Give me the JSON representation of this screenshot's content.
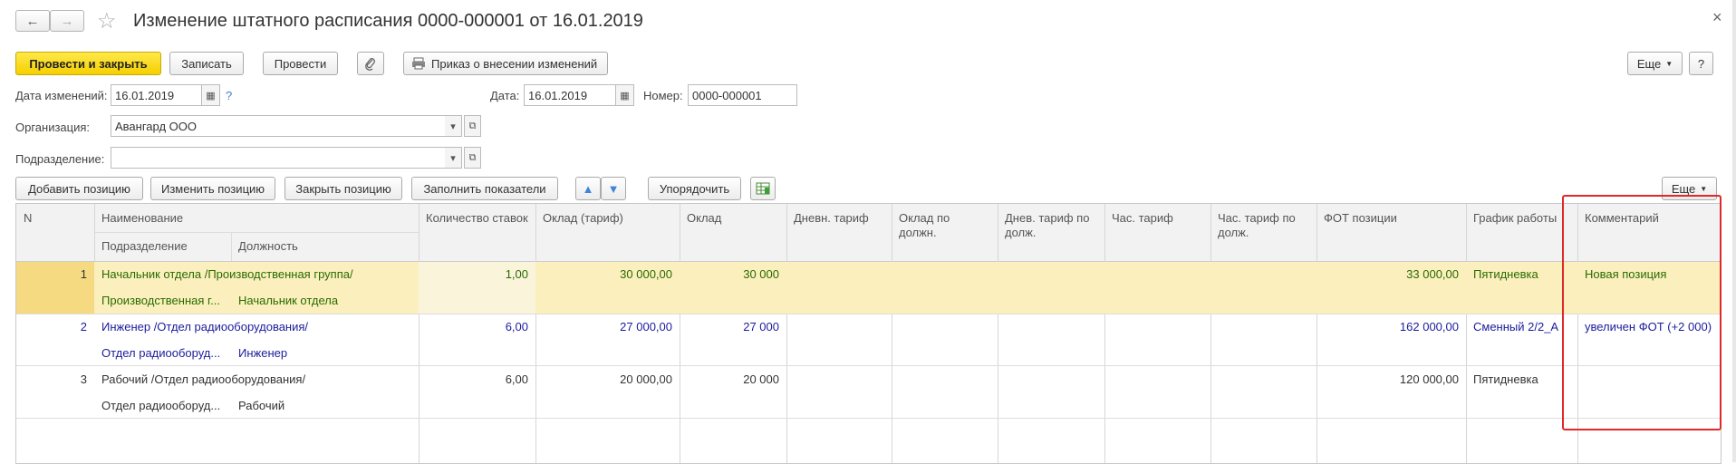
{
  "window": {
    "title": "Изменение штатного расписания 0000-000001 от 16.01.2019",
    "close_glyph": "×",
    "back_glyph": "←",
    "forward_glyph": "→",
    "star_glyph": "☆"
  },
  "toolbar": {
    "post_close": "Провести и закрыть",
    "save": "Записать",
    "post": "Провести",
    "attach_icon": "paperclip-icon",
    "print_order": "Приказ о внесении изменений",
    "more": "Еще",
    "help": "?"
  },
  "form": {
    "change_date_label": "Дата изменений:",
    "change_date_value": "16.01.2019",
    "help_mark": "?",
    "date_label": "Дата:",
    "date_value": "16.01.2019",
    "number_label": "Номер:",
    "number_value": "0000-000001",
    "org_label": "Организация:",
    "org_value": "Авангард ООО",
    "dept_label": "Подразделение:",
    "dept_value": ""
  },
  "table_toolbar": {
    "add": "Добавить позицию",
    "edit": "Изменить позицию",
    "close": "Закрыть позицию",
    "fill": "Заполнить показатели",
    "sort": "Упорядочить",
    "more": "Еще"
  },
  "table": {
    "headers": {
      "n": "N",
      "name": "Наименование",
      "dept": "Подразделение",
      "position": "Должность",
      "rate_count": "Количество ставок",
      "salary_tariff": "Оклад (тариф)",
      "salary": "Оклад",
      "day_tariff": "Дневн. тариф",
      "salary_by_pos": "Оклад по должн.",
      "day_tariff_by_pos": "Днев. тариф по долж.",
      "hour_tariff": "Час. тариф",
      "hour_tariff_by_pos": "Час. тариф по долж.",
      "fot": "ФОТ позиции",
      "schedule": "График работы",
      "comment": "Комментарий"
    },
    "rows": [
      {
        "n": "1",
        "name": "Начальник отдела /Производственная группа/",
        "dept": "Производственная г...",
        "position": "Начальник отдела",
        "rate_count": "1,00",
        "salary_tariff": "30 000,00",
        "salary": "30 000",
        "fot": "33 000,00",
        "schedule": "Пятидневка",
        "comment": "Новая позиция"
      },
      {
        "n": "2",
        "name": "Инженер /Отдел радиооборудования/",
        "dept": "Отдел радиооборуд...",
        "position": "Инженер",
        "rate_count": "6,00",
        "salary_tariff": "27 000,00",
        "salary": "27 000",
        "fot": "162 000,00",
        "schedule": "Сменный 2/2_А",
        "comment": "увеличен ФОТ (+2 000)"
      },
      {
        "n": "3",
        "name": "Рабочий /Отдел радиооборудования/",
        "dept": "Отдел радиооборуд...",
        "position": "Рабочий",
        "rate_count": "6,00",
        "salary_tariff": "20 000,00",
        "salary": "20 000",
        "fot": "120 000,00",
        "schedule": "Пятидневка",
        "comment": ""
      }
    ]
  },
  "colors": {
    "primary_button": "#f5cf00",
    "selected_row": "#fbf0bd",
    "row1_text": "#2a6a00",
    "row2_text": "#1c1c9c",
    "highlight_box": "#e0292b"
  }
}
